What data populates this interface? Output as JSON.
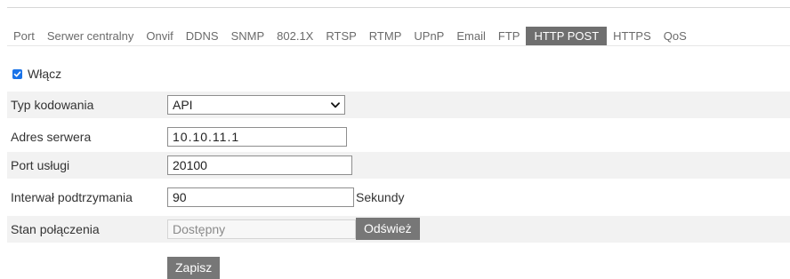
{
  "tabs": [
    {
      "label": "Port",
      "active": false
    },
    {
      "label": "Serwer centralny",
      "active": false
    },
    {
      "label": "Onvif",
      "active": false
    },
    {
      "label": "DDNS",
      "active": false
    },
    {
      "label": "SNMP",
      "active": false
    },
    {
      "label": "802.1X",
      "active": false
    },
    {
      "label": "RTSP",
      "active": false
    },
    {
      "label": "RTMP",
      "active": false
    },
    {
      "label": "UPnP",
      "active": false
    },
    {
      "label": "Email",
      "active": false
    },
    {
      "label": "FTP",
      "active": false
    },
    {
      "label": "HTTP POST",
      "active": true
    },
    {
      "label": "HTTPS",
      "active": false
    },
    {
      "label": "QoS",
      "active": false
    }
  ],
  "enable": {
    "label": "Włącz",
    "checked": true
  },
  "form": {
    "encoding_type": {
      "label": "Typ kodowania",
      "value": "API"
    },
    "server_address": {
      "label": "Adres serwera",
      "value": "10.10.11.1"
    },
    "service_port": {
      "label": "Port usługi",
      "value": "20100"
    },
    "keepalive_interval": {
      "label": "Interwał podtrzymania",
      "value": "90",
      "unit": "Sekundy"
    },
    "connection_status": {
      "label": "Stan połączenia",
      "value": "Dostępny",
      "refresh_label": "Odśwież"
    }
  },
  "save_label": "Zapisz",
  "colors": {
    "accent": "#6f6f6f",
    "checkbox": "#1a73e8",
    "button": "#777777",
    "row_shade": "#f2f2f2"
  }
}
